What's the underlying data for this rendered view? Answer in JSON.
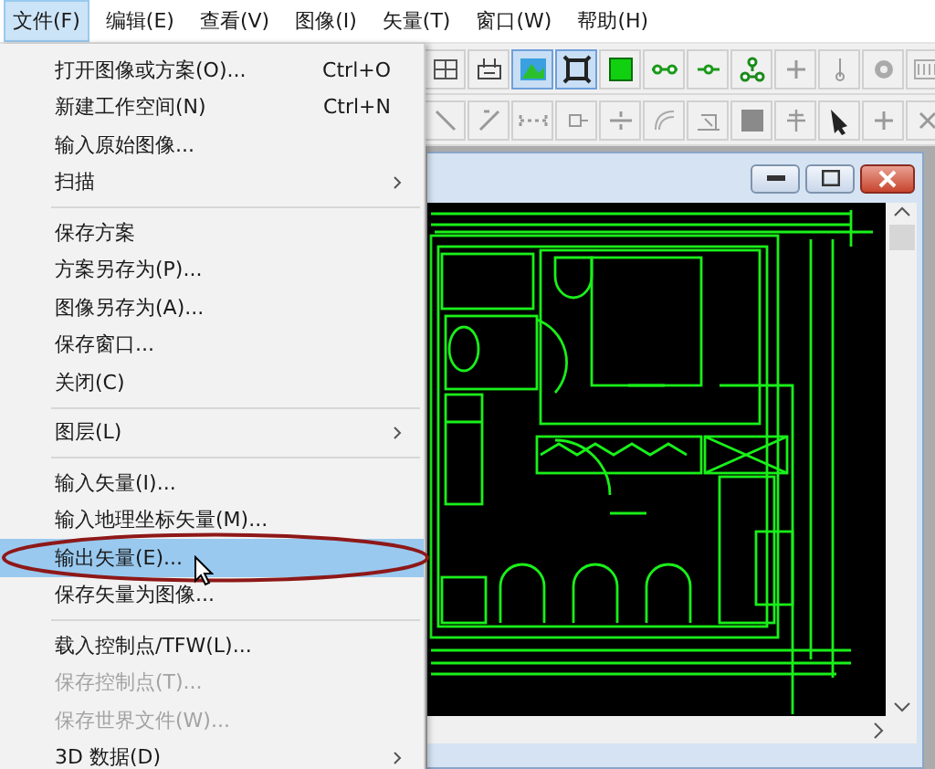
{
  "menubar": [
    {
      "label": "文件(F)",
      "selected": true
    },
    {
      "label": "编辑(E)",
      "selected": false
    },
    {
      "label": "查看(V)",
      "selected": false
    },
    {
      "label": "图像(I)",
      "selected": false
    },
    {
      "label": "矢量(T)",
      "selected": false
    },
    {
      "label": "窗口(W)",
      "selected": false
    },
    {
      "label": "帮助(H)",
      "selected": false
    }
  ],
  "toolbar_rows": [
    {
      "buttons": [
        {
          "selected": false
        },
        {
          "selected": false
        },
        {
          "selected": true
        },
        {
          "selected": true
        },
        {
          "selected": false
        },
        {
          "selected": false
        },
        {
          "selected": false
        },
        {
          "selected": false
        },
        {
          "selected": false
        },
        {
          "selected": false
        },
        {
          "selected": false
        },
        {
          "selected": false
        }
      ]
    },
    {
      "buttons": [
        {
          "selected": false
        },
        {
          "selected": false
        },
        {
          "selected": false
        },
        {
          "selected": false
        },
        {
          "selected": false
        },
        {
          "selected": false
        },
        {
          "selected": false
        },
        {
          "selected": false
        },
        {
          "selected": false
        },
        {
          "selected": false
        },
        {
          "selected": false
        },
        {
          "selected": false
        }
      ]
    }
  ],
  "file_menu": [
    {
      "kind": "item",
      "label": "打开图像或方案(O)...",
      "shortcut": "Ctrl+O",
      "submenu": false,
      "disabled": false,
      "selected": false
    },
    {
      "kind": "item",
      "label": "新建工作空间(N)",
      "shortcut": "Ctrl+N",
      "submenu": false,
      "disabled": false,
      "selected": false
    },
    {
      "kind": "item",
      "label": "输入原始图像...",
      "submenu": false,
      "disabled": false,
      "selected": false
    },
    {
      "kind": "item",
      "label": "扫描",
      "submenu": true,
      "disabled": false,
      "selected": false
    },
    {
      "kind": "separator"
    },
    {
      "kind": "item",
      "label": "保存方案",
      "submenu": false,
      "disabled": false,
      "selected": false
    },
    {
      "kind": "item",
      "label": "方案另存为(P)...",
      "submenu": false,
      "disabled": false,
      "selected": false
    },
    {
      "kind": "item",
      "label": "图像另存为(A)...",
      "submenu": false,
      "disabled": false,
      "selected": false
    },
    {
      "kind": "item",
      "label": "保存窗口...",
      "submenu": false,
      "disabled": false,
      "selected": false
    },
    {
      "kind": "item",
      "label": "关闭(C)",
      "submenu": false,
      "disabled": false,
      "selected": false
    },
    {
      "kind": "separator"
    },
    {
      "kind": "item",
      "label": "图层(L)",
      "submenu": true,
      "disabled": false,
      "selected": false
    },
    {
      "kind": "separator"
    },
    {
      "kind": "item",
      "label": "输入矢量(I)...",
      "submenu": false,
      "disabled": false,
      "selected": false
    },
    {
      "kind": "item",
      "label": "输入地理坐标矢量(M)...",
      "submenu": false,
      "disabled": false,
      "selected": false
    },
    {
      "kind": "item",
      "label": "输出矢量(E)...",
      "submenu": false,
      "disabled": false,
      "selected": true
    },
    {
      "kind": "item",
      "label": "保存矢量为图像...",
      "submenu": false,
      "disabled": false,
      "selected": false
    },
    {
      "kind": "separator"
    },
    {
      "kind": "item",
      "label": "载入控制点/TFW(L)...",
      "submenu": false,
      "disabled": false,
      "selected": false
    },
    {
      "kind": "item",
      "label": "保存控制点(T)...",
      "submenu": false,
      "disabled": true,
      "selected": false
    },
    {
      "kind": "item",
      "label": "保存世界文件(W)...",
      "submenu": false,
      "disabled": true,
      "selected": false
    },
    {
      "kind": "item",
      "label": "3D 数据(D)",
      "submenu": true,
      "disabled": false,
      "selected": false
    }
  ]
}
